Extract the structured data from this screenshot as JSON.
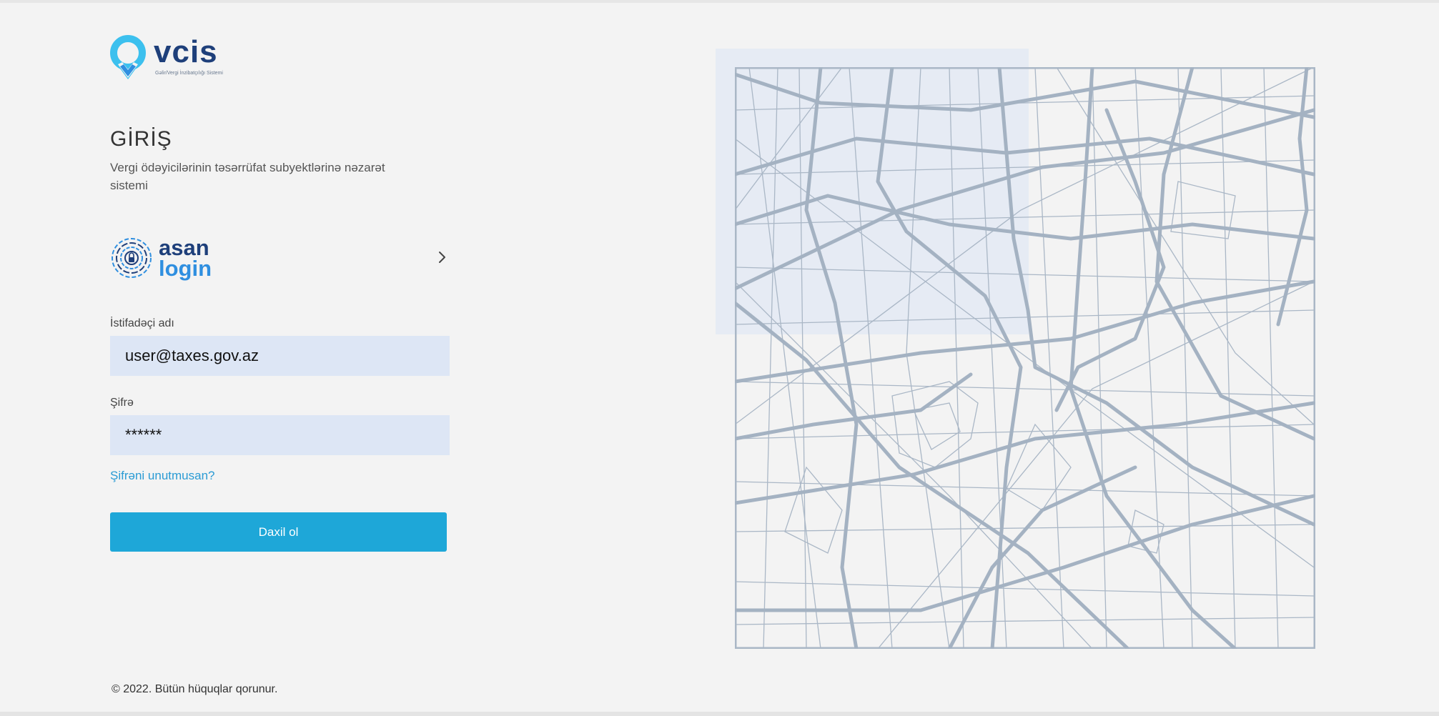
{
  "brand": {
    "name": "vcis",
    "tagline": "Gəlir/Vergi İnzibatçılığı Sistemi"
  },
  "login": {
    "title": "GİRİŞ",
    "subtitle": "Vergi ödəyicilərinin təsərrüfat subyektlərinə nəzarət sistemi",
    "asan_login": {
      "line1": "asan",
      "line2": "login"
    },
    "username_label": "İstifadəçi adı",
    "username_value": "user@taxes.gov.az",
    "password_label": "Şifrə",
    "password_value": "******",
    "forgot_link": "Şifrəni unutmusan?",
    "submit_label": "Daxil ol"
  },
  "footer": {
    "copyright": "© 2022. Bütün hüquqlar qorunur."
  },
  "colors": {
    "background": "#f3f3f3",
    "brand_dark": "#1e3f7a",
    "brand_light": "#2f8fe0",
    "accent": "#1ea7d8",
    "input_bg": "#dde6f5",
    "link": "#2a9bd4",
    "map_lines": "#aab7c6"
  },
  "icons": [
    "vcis-logo-pin-icon",
    "asan-login-fingerprint-icon",
    "chevron-right-icon"
  ]
}
